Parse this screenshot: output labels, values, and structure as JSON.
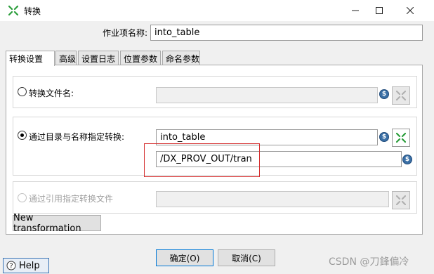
{
  "window": {
    "title": "转换",
    "controls": {
      "minimize_icon": "minimize-icon",
      "maximize_icon": "maximize-icon",
      "close_icon": "close-icon"
    }
  },
  "job_entry_name": {
    "label": "作业项名称:",
    "value": "into_table"
  },
  "tabs": [
    {
      "label": "转换设置",
      "selected": true
    },
    {
      "label": "高级"
    },
    {
      "label": "设置日志"
    },
    {
      "label": "位置参数"
    },
    {
      "label": "命名参数"
    }
  ],
  "options": {
    "by_filename": {
      "label": "转换文件名:",
      "selected": false,
      "value": ""
    },
    "by_directory": {
      "label": "通过目录与名称指定转换:",
      "selected": true,
      "name_value": "into_table",
      "directory_value": "/DX_PROV_OUT/tran"
    },
    "by_reference": {
      "label": "通过引用指定转换文件",
      "selected": false,
      "disabled": true,
      "value": ""
    }
  },
  "variable_icon_glyph": "$",
  "buttons": {
    "new_transformation": "New transformation",
    "ok": "确定(O)",
    "cancel": "取消(C)",
    "help": "Help"
  },
  "watermark": "CSDN @刀鋒偏冷",
  "colors": {
    "accent": "#2a9d3a",
    "highlight_box": "#d42b2b",
    "variable_icon": "#3a6fa5"
  }
}
